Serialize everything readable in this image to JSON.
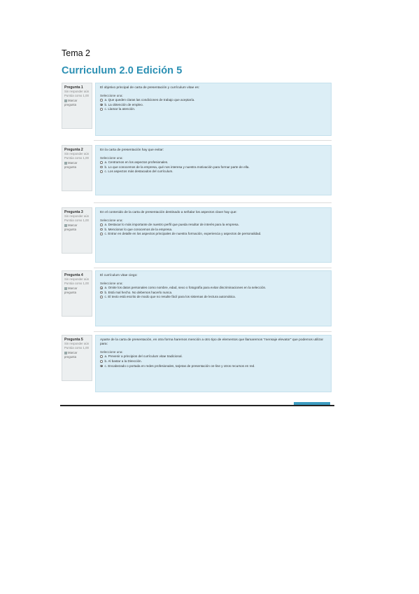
{
  "doc_title": "Tema 2",
  "screenshot": {
    "title": "Curriculum 2.0 Edición 5",
    "questions": [
      {
        "label": "Pregunta 1",
        "status": "Sin responder aún",
        "points": "Puntúa como 1,00",
        "flag": "Marcar pregunta",
        "text": "El objetivo principal de carta de presentación y currículum vitae es:",
        "select_label": "Seleccione una:",
        "options": [
          {
            "text": "a. Que queden claras las condiciones de trabajo que aceptaría.",
            "selected": false
          },
          {
            "text": "b. La obtención de empleo.",
            "selected": true
          },
          {
            "text": "c. Llamar la atención.",
            "selected": false
          }
        ]
      },
      {
        "label": "Pregunta 2",
        "status": "Sin responder aún",
        "points": "Puntúa como 1,00",
        "flag": "Marcar pregunta",
        "text": "En la carta de presentación hay que evitar:",
        "select_label": "Seleccione una:",
        "options": [
          {
            "text": "a. Centrarnos en los aspectos profesionales.",
            "selected": false
          },
          {
            "text": "b. Lo que conocemos de la empresa, qué nos interesa y nuestra motivación para formar parte de ella.",
            "selected": false
          },
          {
            "text": "c. Los aspectos más destacados del currículum.",
            "selected": false
          }
        ]
      },
      {
        "label": "Pregunta 3",
        "status": "Sin responder aún",
        "points": "Puntúa como 1,00",
        "flag": "Marcar pregunta",
        "text": "En el contenido de la carta de presentación destinado a señalar los aspectos clave hay que:",
        "select_label": "Seleccione una:",
        "options": [
          {
            "text": "a. Destacar lo más importante de nuestro perfil que pueda resultar de interés para la empresa.",
            "selected": false
          },
          {
            "text": "b. Mencionar lo que conocemos de la empresa.",
            "selected": false
          },
          {
            "text": "c. Entrar en detalle en los aspectos principales de nuestra formación, experiencia y aspectos de personalidad.",
            "selected": false
          }
        ]
      },
      {
        "label": "Pregunta 4",
        "status": "Sin responder aún",
        "points": "Puntúa como 1,00",
        "flag": "Marcar pregunta",
        "text": "El currículum vitae ciego:",
        "select_label": "Seleccione una:",
        "options": [
          {
            "text": "a. Omite los datos personales como nombre, edad, sexo o fotografía para evitar discriminaciones en la selección.",
            "selected": true
          },
          {
            "text": "b. Está mal hecho. No debemos hacerlo nunca.",
            "selected": false
          },
          {
            "text": "c. El texto está escrito de modo que no resulte fácil para los sistemas de lectura automática.",
            "selected": false
          }
        ]
      },
      {
        "label": "Pregunta 5",
        "status": "Sin responder aún",
        "points": "Puntúa como 1,00",
        "flag": "Marcar pregunta",
        "text": "Aparte de la carta de presentación, en otra forma haremos mención a otro tipo de elementos que llamaremos \"mensaje elevator\" que podemos utilizar para:",
        "select_label": "Seleccione una:",
        "options": [
          {
            "text": "a. Prevenir a principios del currículum vitae tradicional.",
            "selected": false
          },
          {
            "text": "b. Al bastar a la Dirección.",
            "selected": false
          },
          {
            "text": "c. Encabezado o portada en redes profesionales, tarjetas de presentación on-line y otros recursos en red.",
            "selected": true
          }
        ]
      }
    ]
  }
}
